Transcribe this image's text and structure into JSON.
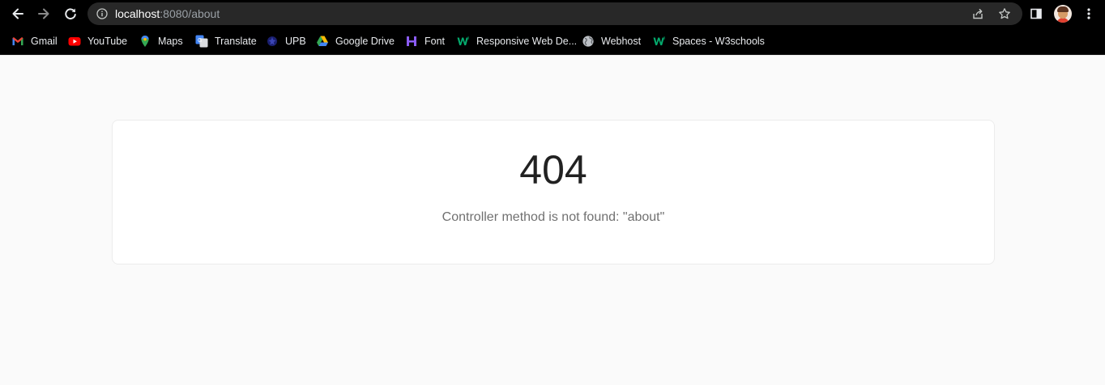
{
  "browser": {
    "url_host": "localhost",
    "url_rest": ":8080/about",
    "icons": {
      "back": "arrow-left-icon",
      "forward": "arrow-right-icon",
      "reload": "reload-icon",
      "info": "info-icon",
      "share": "share-icon",
      "bookmark": "star-icon",
      "side_panel": "side-panel-icon",
      "menu": "kebab-menu-icon"
    }
  },
  "bookmarks": [
    {
      "label": "Gmail",
      "icon": "gmail-icon"
    },
    {
      "label": "YouTube",
      "icon": "youtube-icon"
    },
    {
      "label": "Maps",
      "icon": "maps-icon"
    },
    {
      "label": "Translate",
      "icon": "translate-icon"
    },
    {
      "label": "UPB",
      "icon": "upb-icon"
    },
    {
      "label": "Google Drive",
      "icon": "google-drive-icon"
    },
    {
      "label": "Font",
      "icon": "font-icon"
    },
    {
      "label": "Responsive Web De...",
      "icon": "w3schools-icon"
    },
    {
      "label": "Webhost",
      "icon": "globe-icon"
    },
    {
      "label": "Spaces - W3schools",
      "icon": "w3schools-icon"
    }
  ],
  "page": {
    "error_code": "404",
    "message": "Controller method is not found: \"about\""
  },
  "colors": {
    "chrome_background": "#000000",
    "omnibox_background": "#282828",
    "page_background": "#fafafa",
    "card_background": "#ffffff"
  }
}
